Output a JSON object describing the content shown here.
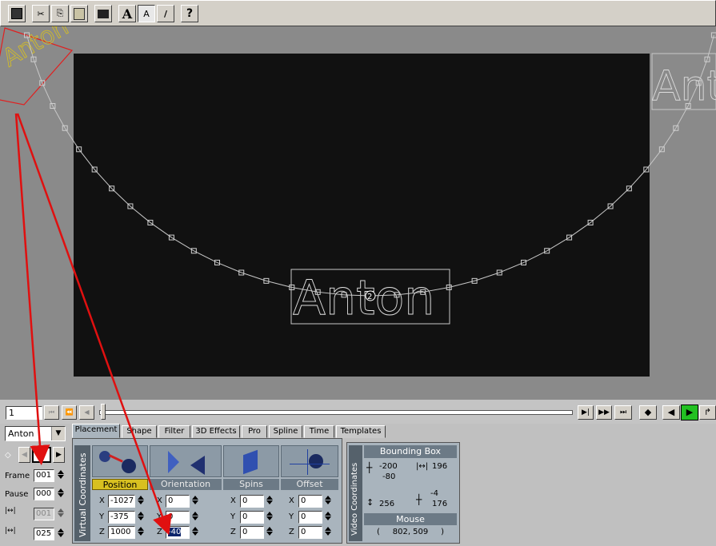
{
  "toolbar": {
    "buttons": [
      {
        "name": "save-icon",
        "glyph": "💾"
      },
      {
        "name": "cut-icon",
        "glyph": "✂"
      },
      {
        "name": "copy-icon",
        "glyph": "⎘"
      },
      {
        "name": "paste-icon",
        "glyph": "📋"
      },
      {
        "name": "clapper-icon",
        "glyph": "🎬"
      },
      {
        "name": "text-tool-icon",
        "glyph": "A"
      },
      {
        "name": "text-select-icon",
        "glyph": "A"
      },
      {
        "name": "brush-icon",
        "glyph": "/"
      },
      {
        "name": "help-icon",
        "glyph": "?"
      }
    ]
  },
  "stage": {
    "title_text": "Anton",
    "keyframe_marker": "2",
    "colors": {
      "background": "#111111",
      "path": "#c8c8c8",
      "start_box": "#e02020",
      "start_text": "#d8c020"
    }
  },
  "timeline": {
    "frame_value": "1",
    "controls": [
      "step-back-to-start",
      "step-back",
      "prev-key",
      "next-key",
      "step-forward",
      "go-to-end",
      "add-key",
      "play-backward",
      "play",
      "loop"
    ]
  },
  "left_panel": {
    "object_select": "Anton",
    "keyframe_number": "1",
    "frame_label": "Frame",
    "frame_value": "001",
    "pause_label": "Pause",
    "pause_value": "000",
    "duration_value": "001",
    "spacing_value": "025"
  },
  "tabs": [
    "Placement",
    "Shape",
    "Filter",
    "3D Effects",
    "Pro",
    "Spline",
    "Time",
    "Templates"
  ],
  "placement": {
    "side_label": "Virtual Coordinates",
    "categories": [
      "Position",
      "Orientation",
      "Spins",
      "Offset"
    ],
    "position": {
      "x": "-1027",
      "y": "-375",
      "z": "1000"
    },
    "orientation": {
      "x": "0",
      "y": "0",
      "z": "-40"
    },
    "spins": {
      "x": "0",
      "y": "0",
      "z": "0"
    },
    "offset": {
      "x": "0",
      "y": "0",
      "z": "0"
    },
    "axis_x": "X",
    "axis_y": "Y",
    "axis_z": "Z"
  },
  "video": {
    "side_label": "Video Coordinates",
    "bounding_title": "Bounding Box",
    "bx": "-200",
    "by": "-80",
    "bw": "196",
    "bh": "256",
    "bz1": "-4",
    "bz2": "176",
    "mouse_title": "Mouse",
    "mouse_value": "(     802, 509     )"
  }
}
